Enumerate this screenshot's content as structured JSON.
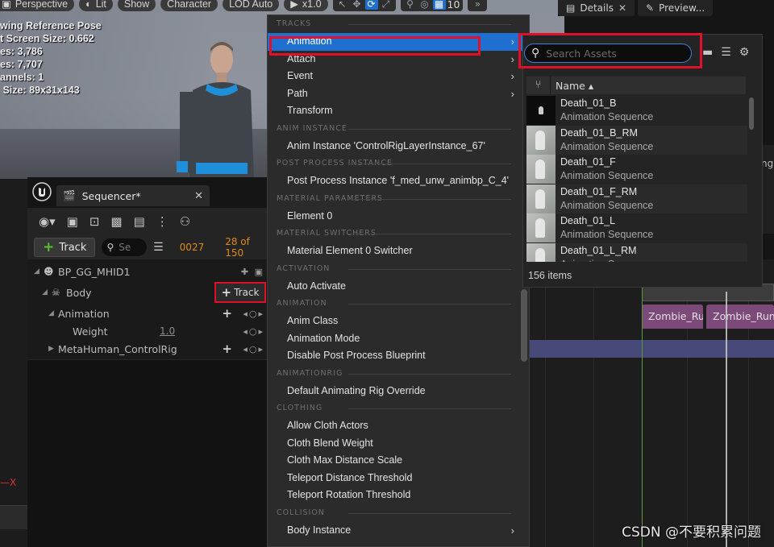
{
  "viewport": {
    "toolbar": {
      "perspective": "Perspective",
      "lit": "Lit",
      "show": "Show",
      "character": "Character",
      "lod": "LOD Auto",
      "play_speed": "x1.0",
      "grid_value": "10"
    },
    "stats": {
      "line1": "wing Reference Pose",
      "line2": "t Screen Size: 0.662",
      "line3": "es: 3,786",
      "line4": "es: 7,707",
      "line5": "annels: 1",
      "line6": " Size: 89x31x143"
    },
    "axis_label": "X"
  },
  "details": {
    "tab1": "Details",
    "tab2": "Preview..."
  },
  "sequencer": {
    "tab_title": "Sequencer*",
    "add_track_label": "Track",
    "search_placeholder": "Se",
    "current_frame": "0027",
    "frame_range": "28 of 150",
    "tree": {
      "bp": "BP_GG_MHID1",
      "body": "Body",
      "body_track_button": "Track",
      "animation": "Animation",
      "weight": "Weight",
      "weight_value": "1.0",
      "control_rig": "MetaHuman_ControlRig"
    }
  },
  "context_menu": {
    "sections": [
      {
        "header": "TRACKS",
        "items": [
          {
            "label": "Animation",
            "submenu": true,
            "highlighted": true
          },
          {
            "label": "Attach",
            "submenu": true
          },
          {
            "label": "Event",
            "submenu": true
          },
          {
            "label": "Path",
            "submenu": true
          },
          {
            "label": "Transform",
            "submenu": false
          }
        ]
      },
      {
        "header": "ANIM INSTANCE",
        "items": [
          {
            "label": "Anim Instance 'ControlRigLayerInstance_67'"
          }
        ]
      },
      {
        "header": "POST PROCESS INSTANCE",
        "items": [
          {
            "label": "Post Process Instance 'f_med_unw_animbp_C_4'"
          }
        ]
      },
      {
        "header": "MATERIAL PARAMETERS",
        "items": [
          {
            "label": "Element 0"
          }
        ]
      },
      {
        "header": "MATERIAL SWITCHERS",
        "items": [
          {
            "label": "Material Element 0 Switcher"
          }
        ]
      },
      {
        "header": "ACTIVATION",
        "items": [
          {
            "label": "Auto Activate"
          }
        ]
      },
      {
        "header": "ANIMATION",
        "items": [
          {
            "label": "Anim Class"
          },
          {
            "label": "Animation Mode"
          },
          {
            "label": "Disable Post Process Blueprint"
          }
        ]
      },
      {
        "header": "ANIMATIONRIG",
        "items": [
          {
            "label": "Default Animating Rig Override"
          }
        ]
      },
      {
        "header": "CLOTHING",
        "items": [
          {
            "label": "Allow Cloth Actors"
          },
          {
            "label": "Cloth Blend Weight"
          },
          {
            "label": "Cloth Max Distance Scale"
          },
          {
            "label": "Teleport Distance Threshold"
          },
          {
            "label": "Teleport Rotation Threshold"
          }
        ]
      },
      {
        "header": "COLLISION",
        "items": [
          {
            "label": "Body Instance",
            "submenu": true
          }
        ]
      }
    ]
  },
  "asset_picker": {
    "search_placeholder": "Search Assets",
    "column_name": "Name",
    "items": [
      {
        "name": "Death_01_B",
        "type": "Animation Sequence",
        "dark": true
      },
      {
        "name": "Death_01_B_RM",
        "type": "Animation Sequence"
      },
      {
        "name": "Death_01_F",
        "type": "Animation Sequence"
      },
      {
        "name": "Death_01_F_RM",
        "type": "Animation Sequence"
      },
      {
        "name": "Death_01_L",
        "type": "Animation Sequence"
      },
      {
        "name": "Death_01_L_RM",
        "type": "Animation Sequence"
      }
    ],
    "count_label": "156 items"
  },
  "timeline": {
    "clip1": "Zombie_Run",
    "clip2": "Zombie_Run"
  },
  "right_panel_fragment": "ng",
  "watermark": "CSDN @不要积累问题"
}
